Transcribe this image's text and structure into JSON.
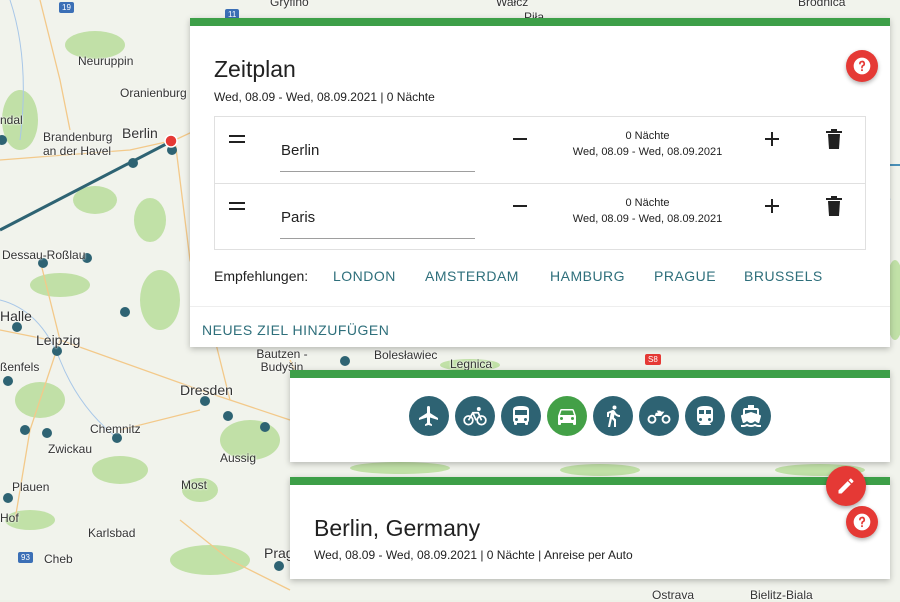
{
  "map": {
    "labels": [
      "Gryfino",
      "Wałcz",
      "Piła",
      "Brodnica",
      "Neuruppin",
      "Oranienburg",
      "Brandenburg an der Havel",
      "Berlin",
      "Dessau-Roßlau",
      "Halle",
      "Leipzig",
      "ßenfels",
      "Bautzen - Budyšin",
      "Bolesławiec",
      "Legnica",
      "Dresden",
      "Chemnitz",
      "Zwickau",
      "Aussig",
      "Plauen",
      "Most",
      "Hof",
      "Karlsbad",
      "Cheb",
      "Prag",
      "Ostrava",
      "Bielitz-Biala",
      "ndal"
    ],
    "road_badges": [
      "19",
      "11",
      "S8",
      "93"
    ],
    "colors": {
      "route": "#2e6373",
      "marker": "#e53935"
    }
  },
  "schedule": {
    "title": "Zeitplan",
    "subtitle": "Wed, 08.09 - Wed, 08.09.2021 | 0 Nächte",
    "help_label": "?",
    "stops": [
      {
        "city": "Berlin",
        "nights": "0 Nächte",
        "dates": "Wed, 08.09 - Wed, 08.09.2021"
      },
      {
        "city": "Paris",
        "nights": "0 Nächte",
        "dates": "Wed, 08.09 - Wed, 08.09.2021"
      }
    ],
    "recommendations_label": "Empfehlungen:",
    "recommendations": [
      "LONDON",
      "AMSTERDAM",
      "HAMBURG",
      "PRAGUE",
      "BRUSSELS"
    ],
    "add_destination": "NEUES ZIEL HINZUFÜGEN"
  },
  "transport": {
    "modes": [
      {
        "name": "plane-icon",
        "active": false
      },
      {
        "name": "bicycle-icon",
        "active": false
      },
      {
        "name": "bus-icon",
        "active": false
      },
      {
        "name": "car-icon",
        "active": true
      },
      {
        "name": "walking-icon",
        "active": false
      },
      {
        "name": "motorcycle-icon",
        "active": false
      },
      {
        "name": "train-icon",
        "active": false
      },
      {
        "name": "ferry-icon",
        "active": false
      }
    ],
    "active_color": "#43a047",
    "inactive_color": "#2e6373"
  },
  "destination": {
    "title": "Berlin, Germany",
    "subtitle": "Wed, 08.09 - Wed, 08.09.2021 | 0 Nächte | Anreise per Auto",
    "help_label": "?"
  },
  "accent": "#3d9f48"
}
